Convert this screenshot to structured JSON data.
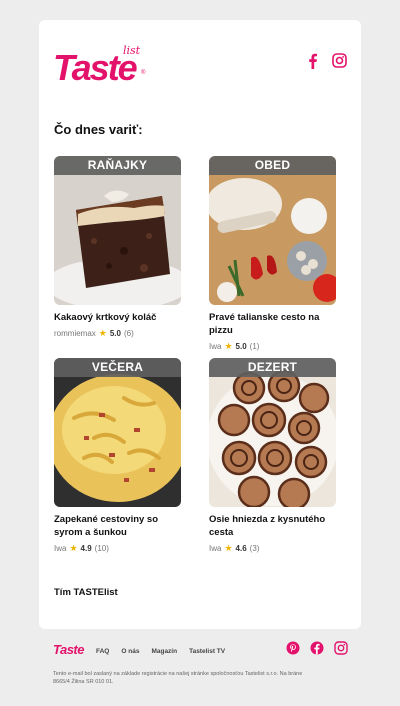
{
  "brand": {
    "name": "Taste",
    "sub": "list",
    "reg": "®",
    "color": "#e3126b"
  },
  "heading": "Čo dnes variť:",
  "recipes": [
    {
      "category": "RAŇAJKY",
      "title": "Kakaový krtkový koláč",
      "author": "rommiemax",
      "rating": "5.0",
      "count": "(6)"
    },
    {
      "category": "OBED",
      "title": "Pravé talianske cesto na pizzu",
      "author": "Iwa",
      "rating": "5.0",
      "count": "(1)"
    },
    {
      "category": "VEČERA",
      "title": "Zapekané cestoviny so syrom a šunkou",
      "author": "Iwa",
      "rating": "4.9",
      "count": "(10)"
    },
    {
      "category": "DEZERT",
      "title": "Osie hniezda z kysnutého cesta",
      "author": "Iwa",
      "rating": "4.6",
      "count": "(3)"
    }
  ],
  "signature": "Tím TASTElist",
  "footer": {
    "logo": "Taste",
    "links": [
      "FAQ",
      "O nás",
      "Magazín",
      "Tastelist TV"
    ],
    "note": "Tento e-mail bol zaslaný na základe registrácie na našej stránke spoločnosťou Tastelist s.r.o. Na bráne 8665/4 Žilina SR 010 01."
  },
  "icons": {
    "facebook": "facebook-icon",
    "instagram": "instagram-icon",
    "pinterest": "pinterest-icon",
    "star": "star-icon"
  }
}
